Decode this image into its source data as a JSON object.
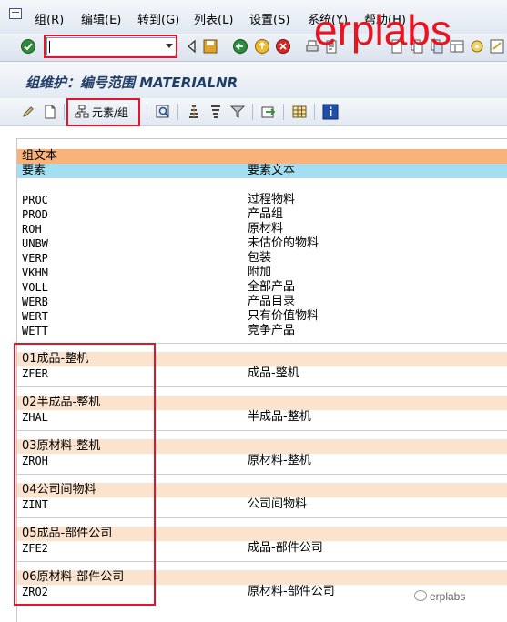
{
  "menu": [
    "组(R)",
    "编辑(E)",
    "转到(G)",
    "列表(L)",
    "设置(S)",
    "系统(Y)",
    "帮助(H)"
  ],
  "command_field": {
    "value": ""
  },
  "watermark": "erplabs",
  "title": "组维护：编号范围 MATERIALNR",
  "toolbar": {
    "elements_groups_label": "元素/组"
  },
  "colors": {
    "header_orange": "#f8b27a",
    "header_cyan": "#a3dff0",
    "group_row": "#fbe3cd",
    "highlight_red": "#e2162b"
  },
  "headers": {
    "group_text": "组文本",
    "element": "要素",
    "element_text": "要素文本"
  },
  "ungrouped": [
    {
      "code": "PROC",
      "text": "过程物料"
    },
    {
      "code": "PROD",
      "text": "产品组"
    },
    {
      "code": "ROH",
      "text": "原材料"
    },
    {
      "code": "UNBW",
      "text": "未估价的物料"
    },
    {
      "code": "VERP",
      "text": "包装"
    },
    {
      "code": "VKHM",
      "text": "附加"
    },
    {
      "code": "VOLL",
      "text": "全部产品"
    },
    {
      "code": "WERB",
      "text": "产品目录"
    },
    {
      "code": "WERT",
      "text": "只有价值物料"
    },
    {
      "code": "WETT",
      "text": "竞争产品"
    }
  ],
  "groups": [
    {
      "name": "01成品-整机",
      "code": "ZFER",
      "text": "成品-整机"
    },
    {
      "name": "02半成品-整机",
      "code": "ZHAL",
      "text": "半成品-整机"
    },
    {
      "name": "03原材料-整机",
      "code": "ZROH",
      "text": "原材料-整机"
    },
    {
      "name": "04公司间物料",
      "code": "ZINT",
      "text": "公司间物料"
    },
    {
      "name": "05成品-部件公司",
      "code": "ZFE2",
      "text": "成品-部件公司"
    },
    {
      "name": "06原材料-部件公司",
      "code": "ZRO2",
      "text": "原材料-部件公司"
    }
  ],
  "wechat_label": "erplabs"
}
